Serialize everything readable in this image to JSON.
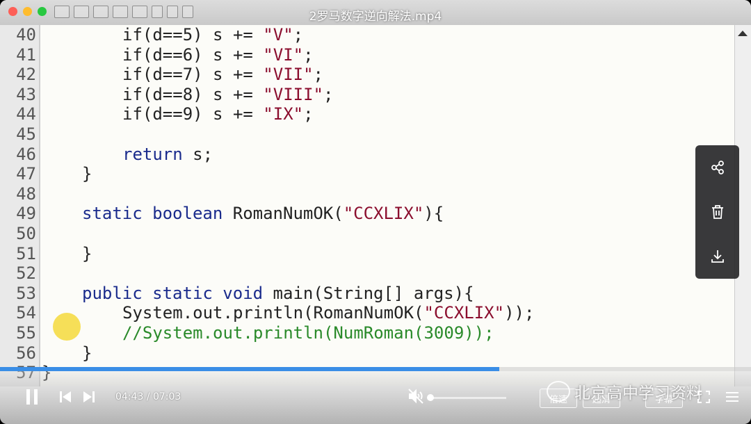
{
  "player": {
    "title": "2罗马数字逆向解法.mp4",
    "current_time": "04:43",
    "duration": "07:03",
    "time_separator": "/",
    "progress_fraction": 0.665,
    "volume_fraction": 0.0,
    "accent_color": "#3a8ee6",
    "pill_buttons": [
      "倍速",
      "超清",
      "字幕"
    ]
  },
  "watermark": "北京高中学习资料",
  "side_actions": [
    "share-icon",
    "trash-icon",
    "download-icon"
  ],
  "editor": {
    "lines": [
      {
        "num": "40",
        "indent": 2,
        "tokens": [
          [
            "",
            "if(d==5) s += "
          ],
          [
            "str",
            "\"V\""
          ],
          [
            "",
            ";"
          ]
        ]
      },
      {
        "num": "41",
        "indent": 2,
        "tokens": [
          [
            "",
            "if(d==6) s += "
          ],
          [
            "str",
            "\"VI\""
          ],
          [
            "",
            ";"
          ]
        ]
      },
      {
        "num": "42",
        "indent": 2,
        "tokens": [
          [
            "",
            "if(d==7) s += "
          ],
          [
            "str",
            "\"VII\""
          ],
          [
            "",
            ";"
          ]
        ]
      },
      {
        "num": "43",
        "indent": 2,
        "tokens": [
          [
            "",
            "if(d==8) s += "
          ],
          [
            "str",
            "\"VIII\""
          ],
          [
            "",
            ";"
          ]
        ]
      },
      {
        "num": "44",
        "indent": 2,
        "tokens": [
          [
            "",
            "if(d==9) s += "
          ],
          [
            "str",
            "\"IX\""
          ],
          [
            "",
            ";"
          ]
        ]
      },
      {
        "num": "45",
        "indent": 0,
        "tokens": []
      },
      {
        "num": "46",
        "indent": 2,
        "tokens": [
          [
            "kw",
            "return"
          ],
          [
            "",
            " s;"
          ]
        ]
      },
      {
        "num": "47",
        "indent": 1,
        "tokens": [
          [
            "",
            "}"
          ]
        ]
      },
      {
        "num": "48",
        "indent": 0,
        "tokens": []
      },
      {
        "num": "49",
        "indent": 1,
        "tokens": [
          [
            "kw",
            "static boolean"
          ],
          [
            "",
            " RomanNumOK("
          ],
          [
            "str",
            "\"CCXLIX\""
          ],
          [
            "",
            "){"
          ]
        ]
      },
      {
        "num": "50",
        "indent": 0,
        "tokens": []
      },
      {
        "num": "51",
        "indent": 1,
        "tokens": [
          [
            "",
            "}"
          ]
        ]
      },
      {
        "num": "52",
        "indent": 0,
        "tokens": []
      },
      {
        "num": "53",
        "indent": 1,
        "tokens": [
          [
            "kw",
            "public static void"
          ],
          [
            "",
            " main(String[] args){"
          ]
        ]
      },
      {
        "num": "54",
        "indent": 2,
        "tokens": [
          [
            "",
            "System.out.println(RomanNumOK("
          ],
          [
            "str",
            "\"CCXLIX\""
          ],
          [
            "",
            "));"
          ]
        ]
      },
      {
        "num": "55",
        "indent": 2,
        "tokens": [
          [
            "cm",
            "//System.out.println(NumRoman(3009));"
          ]
        ]
      },
      {
        "num": "56",
        "indent": 1,
        "tokens": [
          [
            "",
            "}"
          ]
        ]
      },
      {
        "num": "57",
        "indent": 0,
        "tokens": [
          [
            "",
            "}"
          ]
        ]
      }
    ]
  }
}
